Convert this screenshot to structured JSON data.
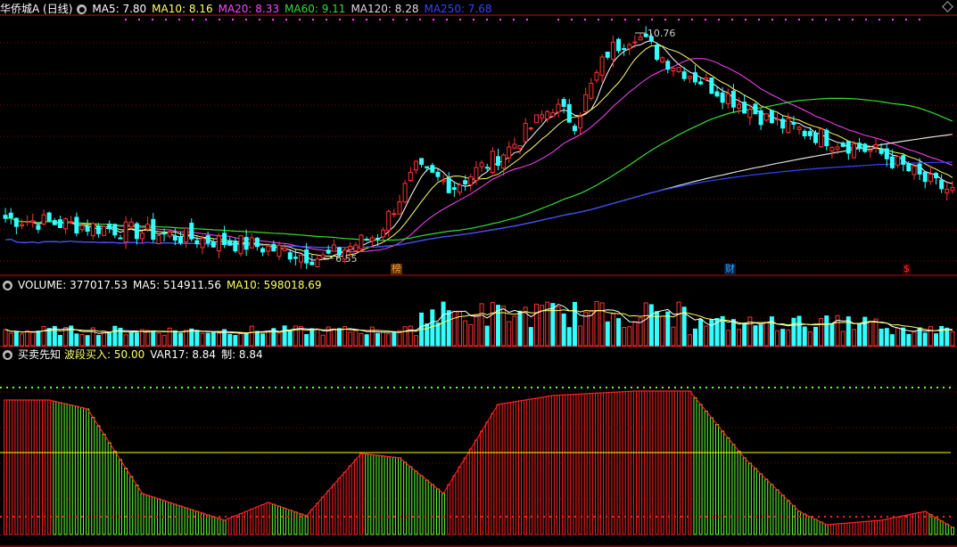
{
  "stock": {
    "title": "华侨城A (日线)"
  },
  "main_indicators": [
    {
      "label": "MA5: 7.80",
      "color": "#ffffff"
    },
    {
      "label": "MA10: 8.16",
      "color": "#ffff66"
    },
    {
      "label": "MA20: 8.33",
      "color": "#ff44ff"
    },
    {
      "label": "MA60: 9.11",
      "color": "#33dd33"
    },
    {
      "label": "MA120: 8.28",
      "color": "#dddddd"
    },
    {
      "label": "MA250: 7.68",
      "color": "#3344ff"
    }
  ],
  "price_marks": {
    "high_label": "10.76",
    "low_label": "6.55"
  },
  "bottom_marks": [
    {
      "text": "榜",
      "color": "#ff9933",
      "bg": "#553300"
    },
    {
      "text": "财",
      "color": "#33aaff",
      "bg": "#002244"
    },
    {
      "text": "$",
      "color": "#ff3333",
      "bg": "#330000"
    }
  ],
  "volume_header": {
    "volume": "VOLUME: 377017.53",
    "ma5": "MA5: 514911.56",
    "ma10": "MA10: 598018.69"
  },
  "indicator_header": {
    "name": "买卖先知",
    "buy": "波段买入: 50.00",
    "var17": "VAR17: 8.84",
    "zhi": "制: 8.84"
  },
  "colors": {
    "up": "#ff3333",
    "down": "#33ffff",
    "grid": "#8b0000",
    "panel_border": "#c01010",
    "osc_up": "#ff2020",
    "osc_down": "#66ff33",
    "mid_line": "#ffff00"
  },
  "chart_data": {
    "type": "candlestick",
    "price_range": [
      6.55,
      10.76
    ],
    "candles_count": 174,
    "key_points": [
      {
        "index": 0,
        "close": 7.3
      },
      {
        "index": 20,
        "close": 7.1
      },
      {
        "index": 45,
        "close": 6.8
      },
      {
        "index": 58,
        "close": 6.55
      },
      {
        "index": 68,
        "close": 7.0
      },
      {
        "index": 75,
        "close": 8.2
      },
      {
        "index": 82,
        "close": 7.9
      },
      {
        "index": 92,
        "close": 8.6
      },
      {
        "index": 100,
        "close": 9.4
      },
      {
        "index": 104,
        "close": 9.1
      },
      {
        "index": 110,
        "close": 10.4
      },
      {
        "index": 115,
        "close": 10.76
      },
      {
        "index": 120,
        "close": 10.3
      },
      {
        "index": 130,
        "close": 9.7
      },
      {
        "index": 140,
        "close": 9.1
      },
      {
        "index": 150,
        "close": 8.8
      },
      {
        "index": 160,
        "close": 8.5
      },
      {
        "index": 168,
        "close": 8.0
      },
      {
        "index": 173,
        "close": 7.8
      }
    ]
  }
}
